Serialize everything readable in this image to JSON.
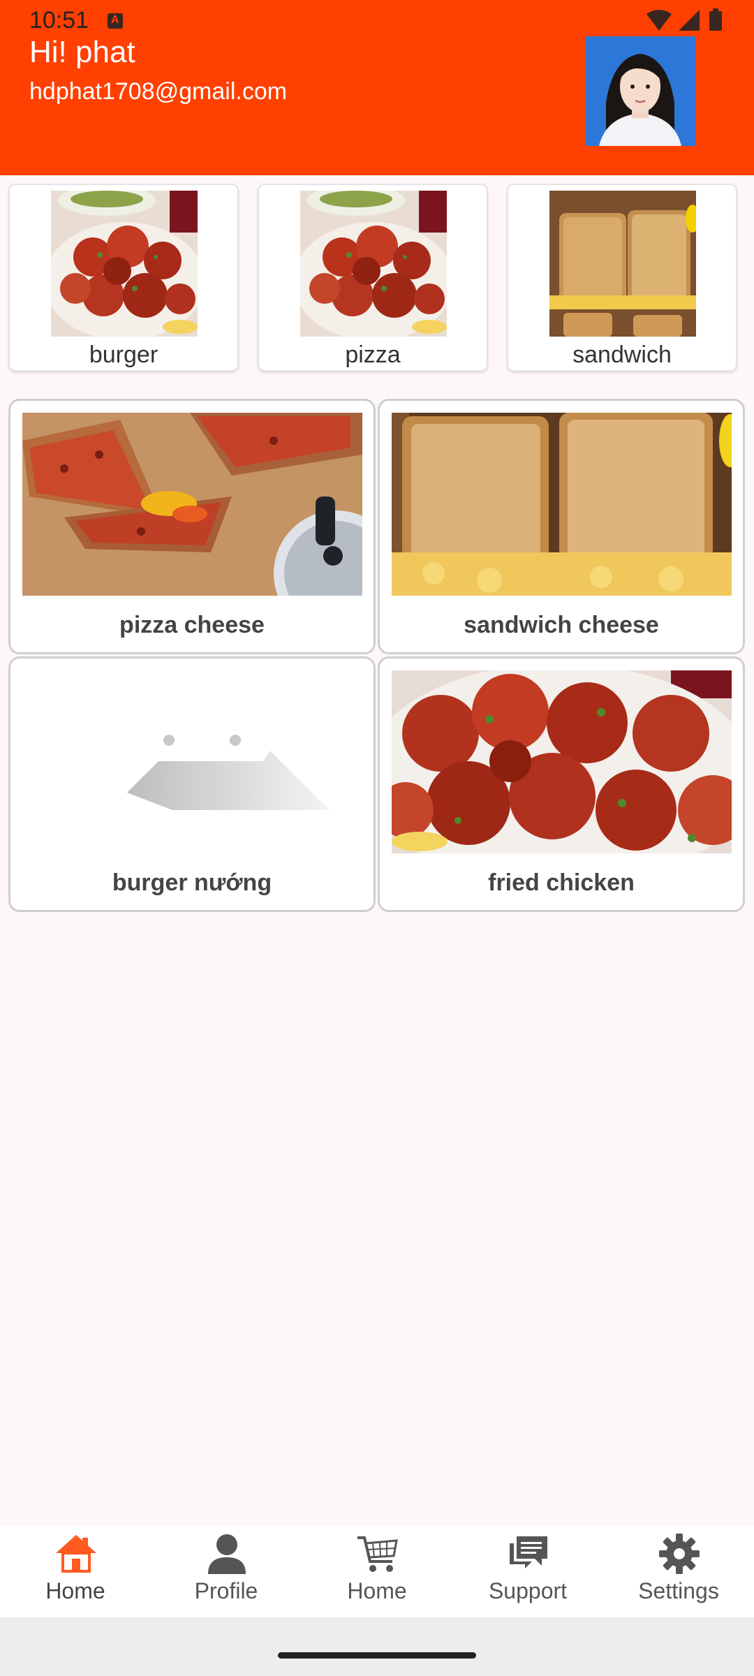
{
  "status": {
    "time": "10:51"
  },
  "header": {
    "greeting": "Hi! phat",
    "email": "hdphat1708@gmail.com",
    "accent": "#ff4000"
  },
  "categories": [
    {
      "label": "burger",
      "image": "tandoori-chicken"
    },
    {
      "label": "pizza",
      "image": "tandoori-chicken"
    },
    {
      "label": "sandwich",
      "image": "grilled-cheese"
    }
  ],
  "products": [
    {
      "label": "pizza cheese",
      "image": "pizza"
    },
    {
      "label": "sandwich cheese",
      "image": "grilled-cheese"
    },
    {
      "label": "burger nướng",
      "image": "placeholder"
    },
    {
      "label": "fried chicken",
      "image": "tandoori-chicken"
    }
  ],
  "nav": [
    {
      "label": "Home",
      "icon": "house-icon",
      "active": true
    },
    {
      "label": "Profile",
      "icon": "person-icon"
    },
    {
      "label": "Home",
      "icon": "cart-icon"
    },
    {
      "label": "Support",
      "icon": "chat-icon"
    },
    {
      "label": "Settings",
      "icon": "gear-icon"
    }
  ],
  "colors": {
    "nav_active": "#ff5a1f",
    "nav_inactive": "#555555"
  }
}
